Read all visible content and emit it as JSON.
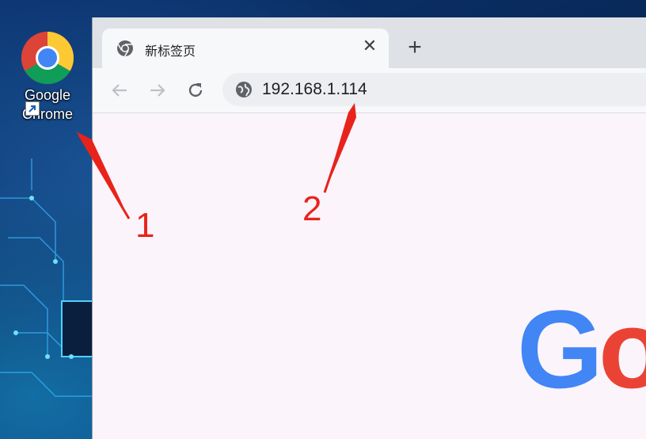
{
  "desktop": {
    "icon": {
      "name": "chrome-desktop-shortcut",
      "label_line1": "Google",
      "label_line2": "Chrome"
    }
  },
  "browser": {
    "tab": {
      "title": "新标签页",
      "close_glyph": "✕"
    },
    "new_tab_glyph": "+",
    "address_bar": {
      "url": "192.168.1.114"
    },
    "content": {
      "logo_letter_1": "G",
      "logo_letter_2": "o"
    }
  },
  "annotations": {
    "step1": "1",
    "step2": "2"
  },
  "colors": {
    "annotation": "#e8231b",
    "google_blue": "#4285f4",
    "google_red": "#ea4335"
  }
}
